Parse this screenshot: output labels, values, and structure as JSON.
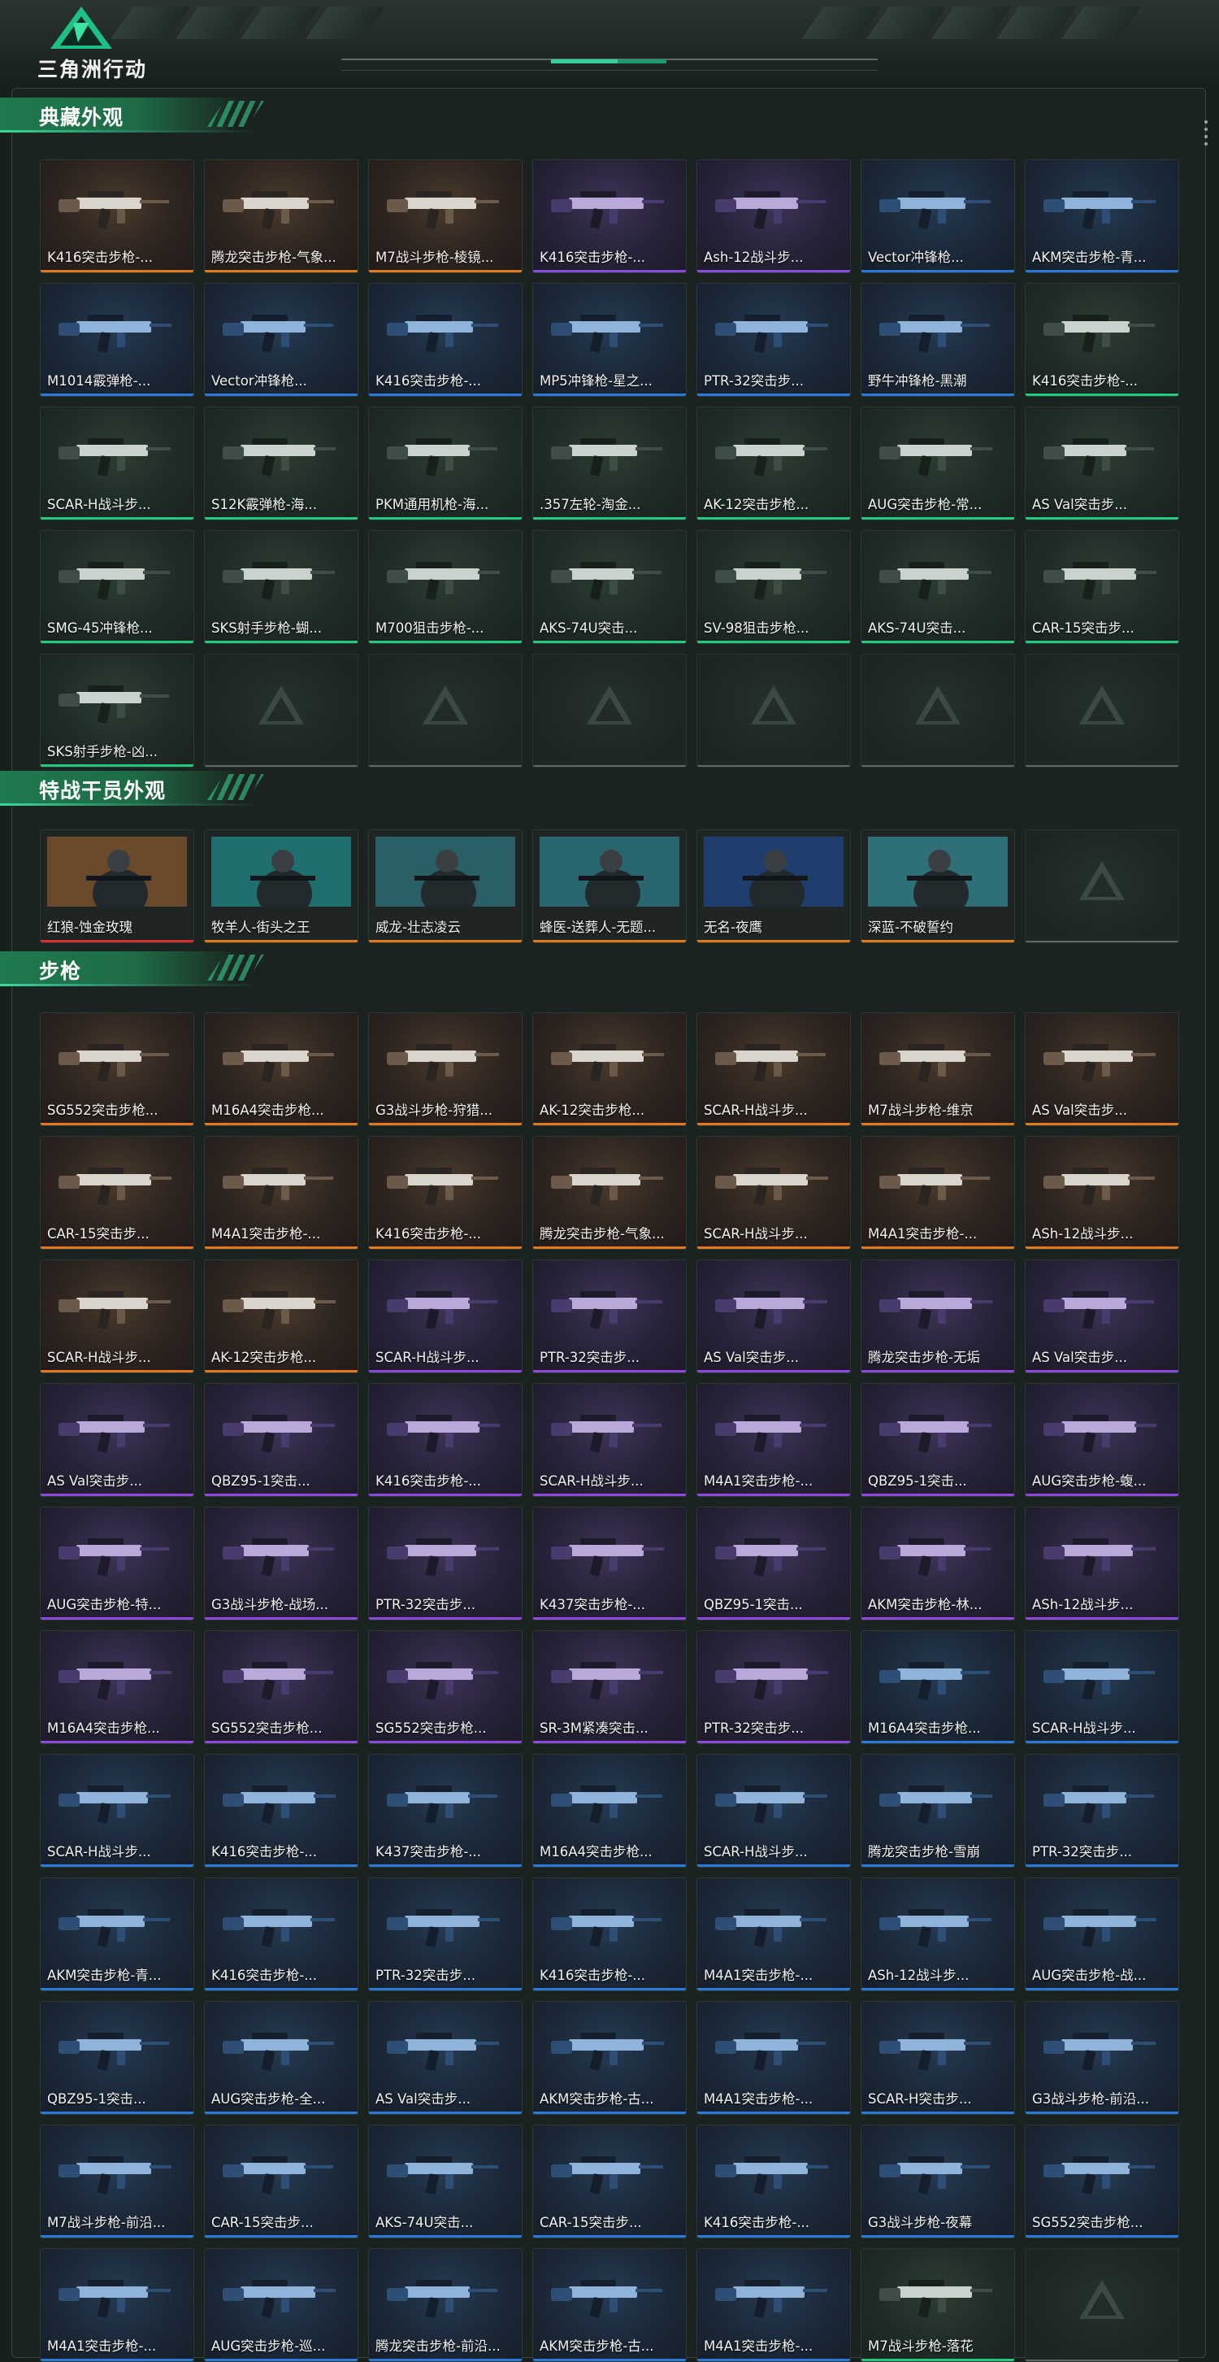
{
  "app": {
    "logo_text": "三角洲行动",
    "logo_icon": "delta-triangle-icon"
  },
  "colors": {
    "gold": "#e07a1c",
    "purple": "#8a4bdc",
    "blue": "#2b79d8",
    "green": "#28c77e",
    "accent": "#33d29a"
  },
  "sections": [
    {
      "title": "典藏外观",
      "items": [
        {
          "name": "K416突击步枪-...",
          "rarity": "gold"
        },
        {
          "name": "腾龙突击步枪-气象...",
          "rarity": "gold"
        },
        {
          "name": "M7战斗步枪-棱镜...",
          "rarity": "gold"
        },
        {
          "name": "K416突击步枪-...",
          "rarity": "purple"
        },
        {
          "name": "Ash-12战斗步...",
          "rarity": "purple"
        },
        {
          "name": "Vector冲锋枪...",
          "rarity": "blue"
        },
        {
          "name": "AKM突击步枪-青...",
          "rarity": "blue"
        },
        {
          "name": "M1014霰弹枪-...",
          "rarity": "blue"
        },
        {
          "name": "Vector冲锋枪...",
          "rarity": "blue"
        },
        {
          "name": "K416突击步枪-...",
          "rarity": "blue"
        },
        {
          "name": "MP5冲锋枪-星之...",
          "rarity": "blue"
        },
        {
          "name": "PTR-32突击步...",
          "rarity": "blue"
        },
        {
          "name": "野牛冲锋枪-黑潮",
          "rarity": "blue"
        },
        {
          "name": "K416突击步枪-...",
          "rarity": "green"
        },
        {
          "name": "SCAR-H战斗步...",
          "rarity": "green"
        },
        {
          "name": "S12K霰弹枪-海...",
          "rarity": "green"
        },
        {
          "name": "PKM通用机枪-海...",
          "rarity": "green"
        },
        {
          "name": ".357左轮-淘金...",
          "rarity": "green"
        },
        {
          "name": "AK-12突击步枪...",
          "rarity": "green"
        },
        {
          "name": "AUG突击步枪-常...",
          "rarity": "green"
        },
        {
          "name": "AS Val突击步...",
          "rarity": "green"
        },
        {
          "name": "SMG-45冲锋枪...",
          "rarity": "green"
        },
        {
          "name": "SKS射手步枪-蝴...",
          "rarity": "green"
        },
        {
          "name": "M700狙击步枪-...",
          "rarity": "green"
        },
        {
          "name": "AKS-74U突击...",
          "rarity": "green"
        },
        {
          "name": "SV-98狙击步枪...",
          "rarity": "green"
        },
        {
          "name": "AKS-74U突击...",
          "rarity": "green"
        },
        {
          "name": "CAR-15突击步...",
          "rarity": "green"
        },
        {
          "name": "SKS射手步枪-凶...",
          "rarity": "green"
        },
        {
          "name": "",
          "rarity": "empty"
        },
        {
          "name": "",
          "rarity": "empty"
        },
        {
          "name": "",
          "rarity": "empty"
        },
        {
          "name": "",
          "rarity": "empty"
        },
        {
          "name": "",
          "rarity": "empty"
        },
        {
          "name": "",
          "rarity": "empty"
        }
      ]
    },
    {
      "title": "特战干员外观",
      "items": [
        {
          "name": "红狼-蚀金玫瑰",
          "rarity": "red",
          "kind": "operator"
        },
        {
          "name": "牧羊人-街头之王",
          "rarity": "gold",
          "kind": "operator"
        },
        {
          "name": "威龙-壮志凌云",
          "rarity": "gold",
          "kind": "operator"
        },
        {
          "name": "蜂医-送葬人-无题...",
          "rarity": "gold",
          "kind": "operator"
        },
        {
          "name": "无名-夜鹰",
          "rarity": "gold",
          "kind": "operator"
        },
        {
          "name": "深蓝-不破誓约",
          "rarity": "gold",
          "kind": "operator"
        },
        {
          "name": "",
          "rarity": "empty"
        }
      ]
    },
    {
      "title": "步枪",
      "items": [
        {
          "name": "SG552突击步枪...",
          "rarity": "gold"
        },
        {
          "name": "M16A4突击步枪...",
          "rarity": "gold"
        },
        {
          "name": "G3战斗步枪-狩猎...",
          "rarity": "gold"
        },
        {
          "name": "AK-12突击步枪...",
          "rarity": "gold"
        },
        {
          "name": "SCAR-H战斗步...",
          "rarity": "gold"
        },
        {
          "name": "M7战斗步枪-维京",
          "rarity": "gold"
        },
        {
          "name": "AS Val突击步...",
          "rarity": "gold"
        },
        {
          "name": "CAR-15突击步...",
          "rarity": "gold"
        },
        {
          "name": "M4A1突击步枪-...",
          "rarity": "gold"
        },
        {
          "name": "K416突击步枪-...",
          "rarity": "gold"
        },
        {
          "name": "腾龙突击步枪-气象...",
          "rarity": "gold"
        },
        {
          "name": "SCAR-H战斗步...",
          "rarity": "gold"
        },
        {
          "name": "M4A1突击步枪-...",
          "rarity": "gold"
        },
        {
          "name": "ASh-12战斗步...",
          "rarity": "gold"
        },
        {
          "name": "SCAR-H战斗步...",
          "rarity": "gold"
        },
        {
          "name": "AK-12突击步枪...",
          "rarity": "gold"
        },
        {
          "name": "SCAR-H战斗步...",
          "rarity": "purple"
        },
        {
          "name": "PTR-32突击步...",
          "rarity": "purple"
        },
        {
          "name": "AS Val突击步...",
          "rarity": "purple"
        },
        {
          "name": "腾龙突击步枪-无垢",
          "rarity": "purple"
        },
        {
          "name": "AS Val突击步...",
          "rarity": "purple"
        },
        {
          "name": "AS Val突击步...",
          "rarity": "purple"
        },
        {
          "name": "QBZ95-1突击...",
          "rarity": "purple"
        },
        {
          "name": "K416突击步枪-...",
          "rarity": "purple"
        },
        {
          "name": "SCAR-H战斗步...",
          "rarity": "purple"
        },
        {
          "name": "M4A1突击步枪-...",
          "rarity": "purple"
        },
        {
          "name": "QBZ95-1突击...",
          "rarity": "purple"
        },
        {
          "name": "AUG突击步枪-蝮...",
          "rarity": "purple"
        },
        {
          "name": "AUG突击步枪-特...",
          "rarity": "purple"
        },
        {
          "name": "G3战斗步枪-战场...",
          "rarity": "purple"
        },
        {
          "name": "PTR-32突击步...",
          "rarity": "purple"
        },
        {
          "name": "K437突击步枪-...",
          "rarity": "purple"
        },
        {
          "name": "QBZ95-1突击...",
          "rarity": "purple"
        },
        {
          "name": "AKM突击步枪-林...",
          "rarity": "purple"
        },
        {
          "name": "ASh-12战斗步...",
          "rarity": "purple"
        },
        {
          "name": "M16A4突击步枪...",
          "rarity": "purple"
        },
        {
          "name": "SG552突击步枪...",
          "rarity": "purple"
        },
        {
          "name": "SG552突击步枪...",
          "rarity": "purple"
        },
        {
          "name": "SR-3M紧凑突击...",
          "rarity": "purple"
        },
        {
          "name": "PTR-32突击步...",
          "rarity": "purple"
        },
        {
          "name": "M16A4突击步枪...",
          "rarity": "blue"
        },
        {
          "name": "SCAR-H战斗步...",
          "rarity": "blue"
        },
        {
          "name": "SCAR-H战斗步...",
          "rarity": "blue"
        },
        {
          "name": "K416突击步枪-...",
          "rarity": "blue"
        },
        {
          "name": "K437突击步枪-...",
          "rarity": "blue"
        },
        {
          "name": "M16A4突击步枪...",
          "rarity": "blue"
        },
        {
          "name": "SCAR-H战斗步...",
          "rarity": "blue"
        },
        {
          "name": "腾龙突击步枪-雪崩",
          "rarity": "blue"
        },
        {
          "name": "PTR-32突击步...",
          "rarity": "blue"
        },
        {
          "name": "AKM突击步枪-青...",
          "rarity": "blue"
        },
        {
          "name": "K416突击步枪-...",
          "rarity": "blue"
        },
        {
          "name": "PTR-32突击步...",
          "rarity": "blue"
        },
        {
          "name": "K416突击步枪-...",
          "rarity": "blue"
        },
        {
          "name": "M4A1突击步枪-...",
          "rarity": "blue"
        },
        {
          "name": "ASh-12战斗步...",
          "rarity": "blue"
        },
        {
          "name": "AUG突击步枪-战...",
          "rarity": "blue"
        },
        {
          "name": "QBZ95-1突击...",
          "rarity": "blue"
        },
        {
          "name": "AUG突击步枪-全...",
          "rarity": "blue"
        },
        {
          "name": "AS Val突击步...",
          "rarity": "blue"
        },
        {
          "name": "AKM突击步枪-古...",
          "rarity": "blue"
        },
        {
          "name": "M4A1突击步枪-...",
          "rarity": "blue"
        },
        {
          "name": "SCAR-H突击步...",
          "rarity": "blue"
        },
        {
          "name": "G3战斗步枪-前沿...",
          "rarity": "blue"
        },
        {
          "name": "M7战斗步枪-前沿...",
          "rarity": "blue"
        },
        {
          "name": "CAR-15突击步...",
          "rarity": "blue"
        },
        {
          "name": "AKS-74U突击...",
          "rarity": "blue"
        },
        {
          "name": "CAR-15突击步...",
          "rarity": "blue"
        },
        {
          "name": "K416突击步枪-...",
          "rarity": "blue"
        },
        {
          "name": "G3战斗步枪-夜幕",
          "rarity": "blue"
        },
        {
          "name": "SG552突击步枪...",
          "rarity": "blue"
        },
        {
          "name": "M4A1突击步枪-...",
          "rarity": "blue"
        },
        {
          "name": "AUG突击步枪-巡...",
          "rarity": "blue"
        },
        {
          "name": "腾龙突击步枪-前沿...",
          "rarity": "blue"
        },
        {
          "name": "AKM突击步枪-古...",
          "rarity": "blue"
        },
        {
          "name": "M4A1突击步枪-...",
          "rarity": "blue"
        },
        {
          "name": "M7战斗步枪-落花",
          "rarity": "green"
        },
        {
          "name": "",
          "rarity": "empty"
        }
      ]
    }
  ]
}
